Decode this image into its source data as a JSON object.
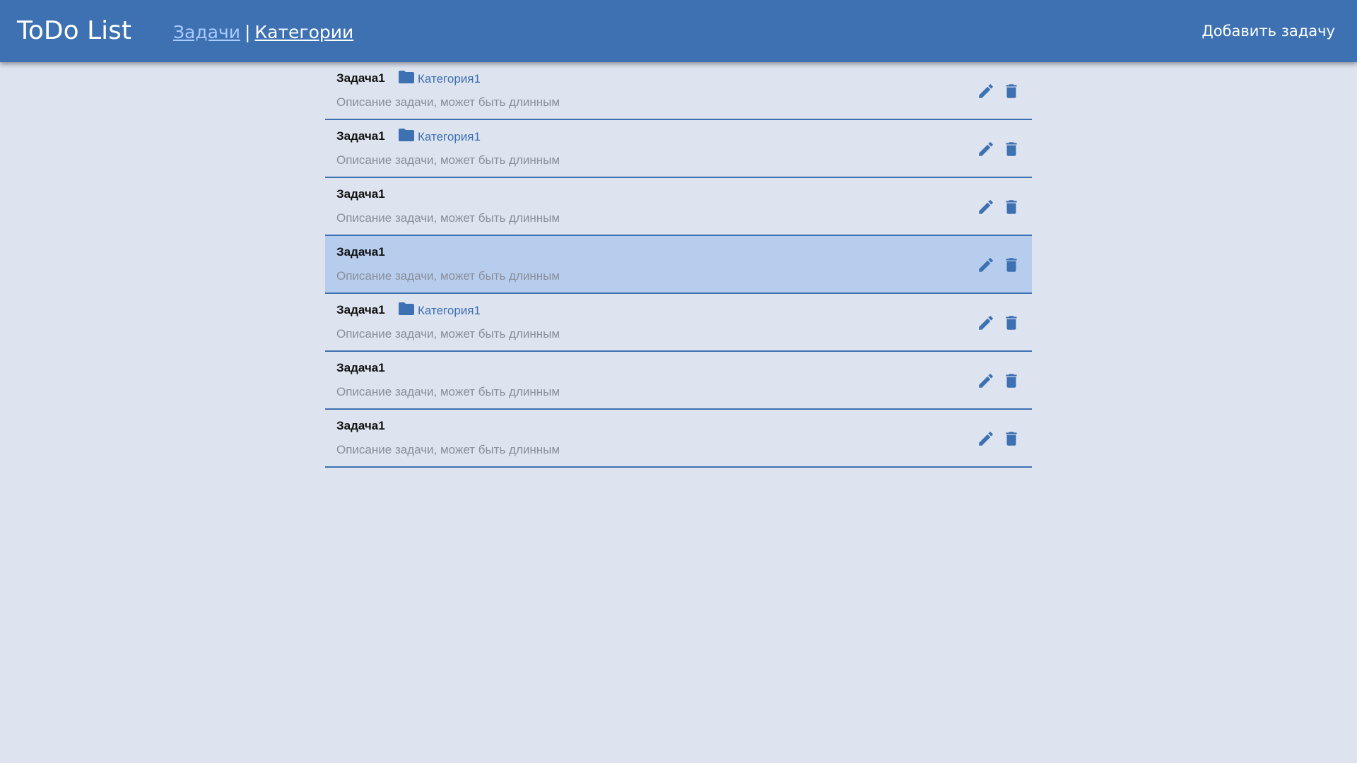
{
  "header": {
    "title": "ToDo List",
    "nav": [
      {
        "label": "Задачи",
        "active": true
      },
      {
        "label": "Категории",
        "active": false
      }
    ],
    "separator": "|",
    "add_task_label": "Добавить задачу"
  },
  "colors": {
    "primary": "#3e71b1",
    "background": "#dde3ef",
    "selected_row": "#b7cdee",
    "active_nav": "#a9cbff"
  },
  "tasks": [
    {
      "title": "Задача1",
      "category": "Категория1",
      "description": "Описание задачи, может быть длинным",
      "selected": false
    },
    {
      "title": "Задача1",
      "category": "Категория1",
      "description": "Описание задачи, может быть длинным",
      "selected": false
    },
    {
      "title": "Задача1",
      "category": "",
      "description": "Описание задачи, может быть длинным",
      "selected": false
    },
    {
      "title": "Задача1",
      "category": "",
      "description": "Описание задачи, может быть длинным",
      "selected": true
    },
    {
      "title": "Задача1",
      "category": "Категория1",
      "description": "Описание задачи, может быть длинным",
      "selected": false
    },
    {
      "title": "Задача1",
      "category": "",
      "description": "Описание задачи, может быть длинным",
      "selected": false
    },
    {
      "title": "Задача1",
      "category": "",
      "description": "Описание задачи, может быть длинным",
      "selected": false
    }
  ],
  "icons": {
    "category": "folder-icon",
    "edit": "pencil-icon",
    "delete": "trash-icon"
  }
}
